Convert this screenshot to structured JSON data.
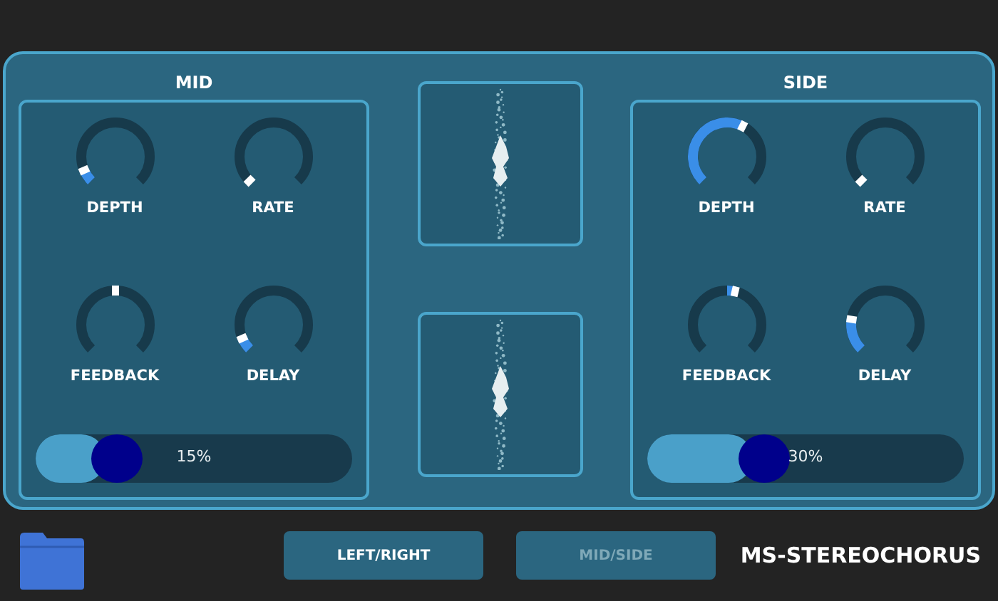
{
  "sections": [
    {
      "title": "MID",
      "knobs": [
        {
          "label": "DEPTH",
          "kind": "unipolar"
        },
        {
          "label": "RATE",
          "kind": "unipolar"
        },
        {
          "label": "FEEDBACK",
          "kind": "bipolar"
        },
        {
          "label": "DELAY",
          "kind": "unipolar"
        }
      ],
      "slider": {
        "level": 0.15,
        "reading": "15%"
      }
    },
    {
      "title": "SIDE",
      "knobs": [
        {
          "label": "DEPTH",
          "kind": "unipolar"
        },
        {
          "label": "RATE",
          "kind": "unipolar"
        },
        {
          "label": "FEEDBACK",
          "kind": "bipolar"
        },
        {
          "label": "DELAY",
          "kind": "unipolar"
        }
      ],
      "slider": {
        "level": 0.3,
        "reading": "30%"
      }
    }
  ],
  "modes": [
    {
      "label": "LEFT/RIGHT",
      "selected": true
    },
    {
      "label": "MID/SIDE",
      "selected": false
    }
  ],
  "plugin_name": "MS-STEREOCHORUS"
}
